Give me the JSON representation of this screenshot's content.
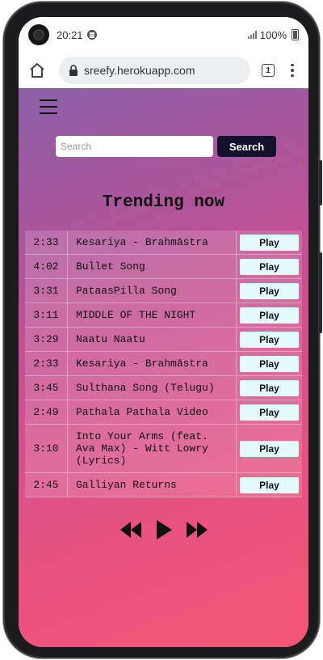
{
  "status_bar": {
    "time": "20:21",
    "battery": "100%"
  },
  "browser": {
    "url": "sreefy.herokuapp.com",
    "tab_count": "1"
  },
  "search": {
    "placeholder": "Search",
    "value": "",
    "button_label": "Search"
  },
  "heading": "Trending now",
  "play_label": "Play",
  "tracks": [
    {
      "duration": "2:33",
      "title": "Kesariya - Brahmāstra"
    },
    {
      "duration": "4:02",
      "title": "Bullet Song"
    },
    {
      "duration": "3:31",
      "title": "PataasPilla Song"
    },
    {
      "duration": "3:11",
      "title": "MIDDLE OF THE NIGHT"
    },
    {
      "duration": "3:29",
      "title": "Naatu Naatu"
    },
    {
      "duration": "2:33",
      "title": "Kesariya - Brahmāstra"
    },
    {
      "duration": "3:45",
      "title": "Sulthana Song (Telugu)"
    },
    {
      "duration": "2:49",
      "title": "Pathala Pathala Video"
    },
    {
      "duration": "3:10",
      "title": "Into Your Arms (feat. Ava Max) - Witt Lowry (Lyrics)"
    },
    {
      "duration": "2:45",
      "title": "Galliyan Returns"
    }
  ],
  "player_controls": [
    "rewind-icon",
    "play-icon",
    "fast-forward-icon"
  ],
  "icons": {
    "home": "home-icon",
    "lock": "lock-icon",
    "tabs": "tab-count-icon",
    "menu": "kebab-menu-icon",
    "page_menu": "hamburger-icon"
  },
  "colors": {
    "search_button": "#140f2a",
    "play_button": "#e5fafa",
    "gradient_top": "#8a5fa8",
    "gradient_bottom": "#f45574"
  }
}
